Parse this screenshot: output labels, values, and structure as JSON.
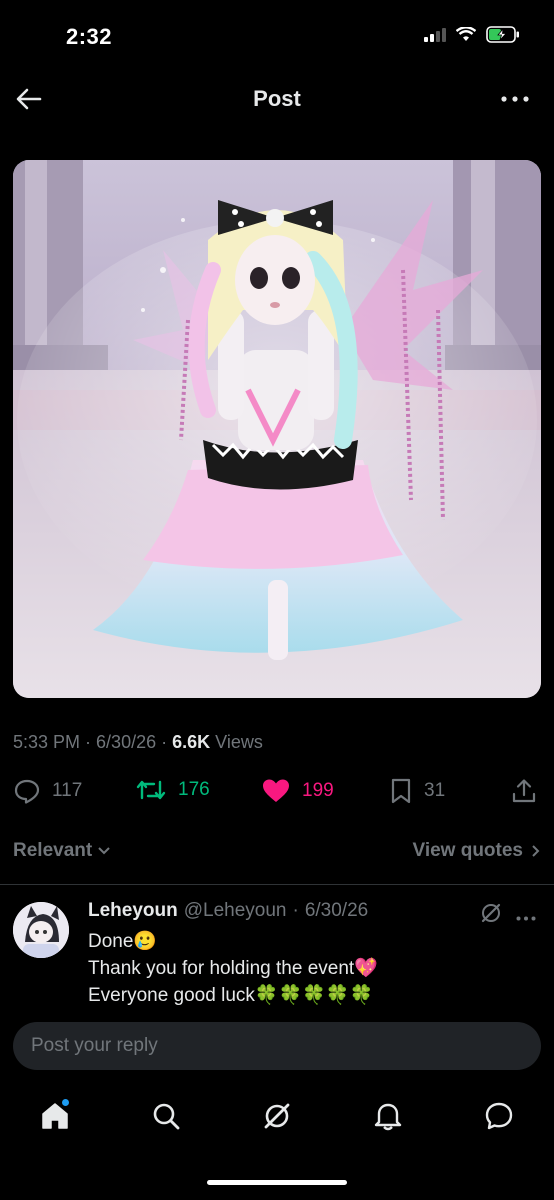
{
  "status_bar": {
    "time": "2:32"
  },
  "header": {
    "title": "Post"
  },
  "post": {
    "meta_time": "5:33 PM",
    "meta_date": "6/30/26",
    "views_count": "6.6K",
    "views_label": "Views",
    "replies": "117",
    "reposts": "176",
    "likes": "199",
    "bookmarks": "31"
  },
  "sort": {
    "label": "Relevant",
    "view_quotes": "View quotes"
  },
  "reply": {
    "name": "Leheyoun",
    "handle": "@Leheyoun",
    "date": "6/30/26",
    "line1": "Done🥲",
    "line2": "Thank you for holding the event💖",
    "line3": "Everyone good luck🍀🍀🍀🍀🍀"
  },
  "composer": {
    "placeholder": "Post your reply"
  },
  "colors": {
    "like": "#f91880",
    "repost": "#00ba7c",
    "accent": "#1d9bf0",
    "muted": "#71767b"
  }
}
